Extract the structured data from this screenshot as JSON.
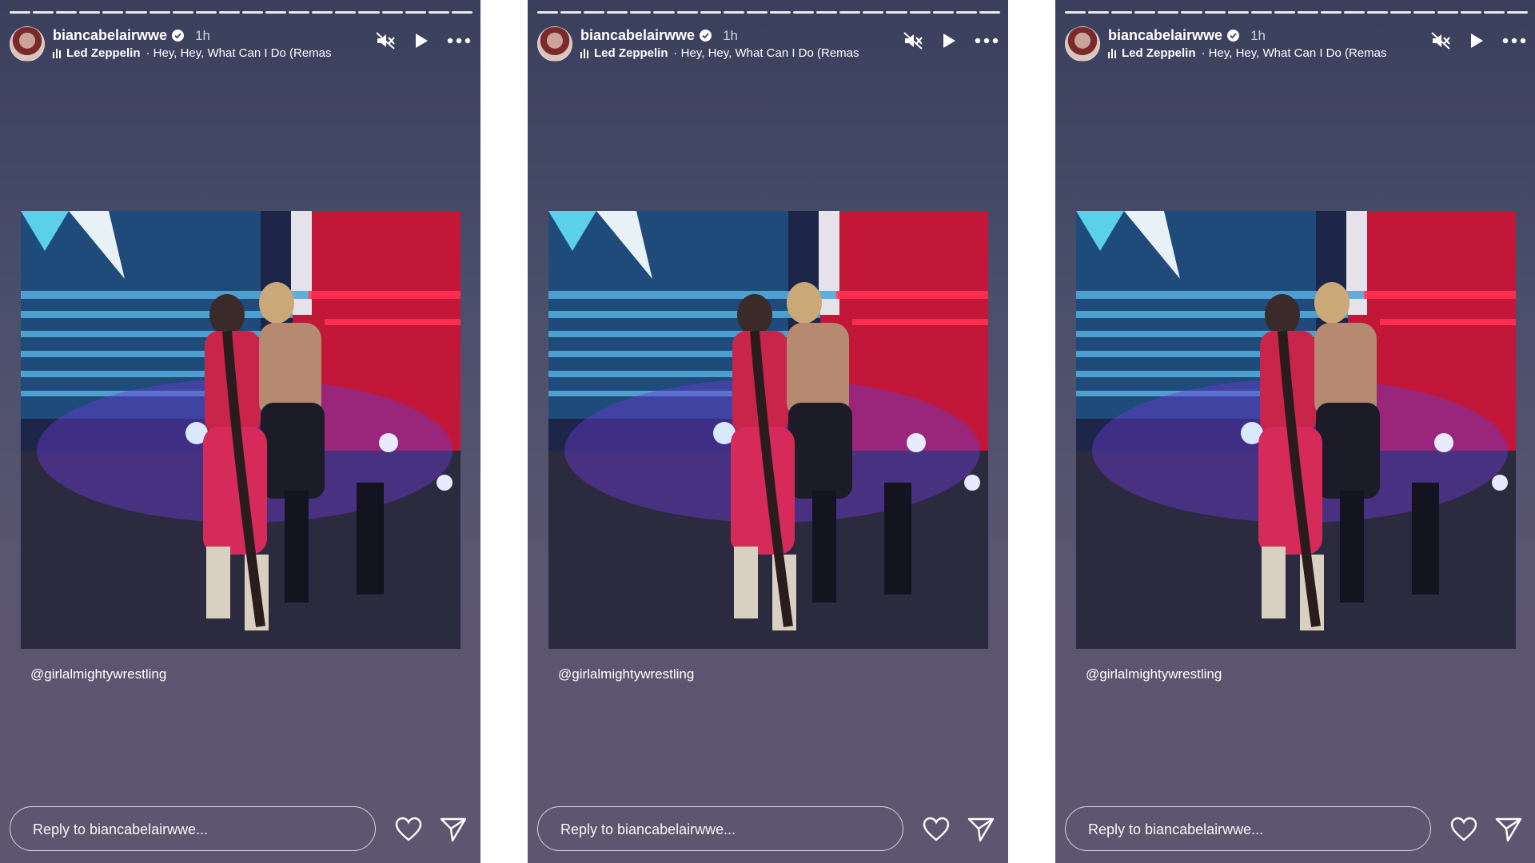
{
  "stories": [
    {
      "username": "biancabelairwwe",
      "time": "1h",
      "music_artist": "Led Zeppelin",
      "music_title": "· Hey, Hey, What Can I Do (Remas",
      "caption": "@girlalmightywrestling",
      "reply_placeholder": "Reply to biancabelairwwe..."
    },
    {
      "username": "biancabelairwwe",
      "time": "1h",
      "music_artist": "Led Zeppelin",
      "music_title": "· Hey, Hey, What Can I Do (Remas",
      "caption": "@girlalmightywrestling",
      "reply_placeholder": "Reply to biancabelairwwe..."
    },
    {
      "username": "biancabelairwwe",
      "time": "1h",
      "music_artist": "Led Zeppelin",
      "music_title": "· Hey, Hey, What Can I Do (Remas",
      "caption": "@girlalmightywrestling",
      "reply_placeholder": "Reply to biancabelairwwe..."
    }
  ],
  "icons": {
    "mute": "speaker-muted-icon",
    "play": "play-icon",
    "more": "more-horizontal-icon",
    "like": "heart-icon",
    "share": "send-icon",
    "verified": "verified-badge-icon",
    "music": "music-bars-icon"
  },
  "colors": {
    "panel_top": "#3a3f5c",
    "panel_bottom": "#5e5670",
    "text": "#ffffff"
  }
}
